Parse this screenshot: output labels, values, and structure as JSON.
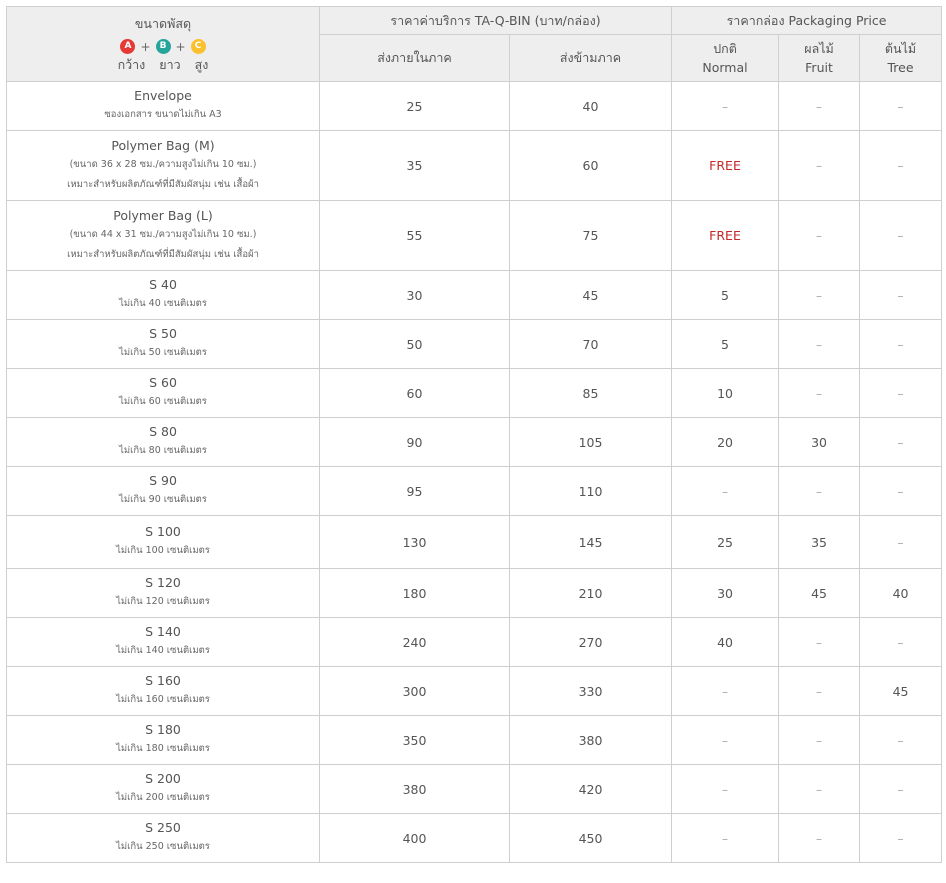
{
  "header": {
    "size_col": "ขนาดพัสดุ",
    "legend": {
      "a": "A",
      "b": "B",
      "c": "C",
      "plus": "+",
      "width": "กว้าง",
      "length": "ยาว",
      "height": "สูง"
    },
    "service_group": "ราคาค่าบริการ TA-Q-BIN (บาท/กล่อง)",
    "packaging_group": "ราคากล่อง Packaging Price",
    "domestic": "ส่งภายในภาค",
    "cross_region": "ส่งข้ามภาค",
    "normal_th": "ปกติ",
    "normal_en": "Normal",
    "fruit_th": "ผลไม้",
    "fruit_en": "Fruit",
    "tree_th": "ต้นไม้",
    "tree_en": "Tree"
  },
  "rows": [
    {
      "name": "Envelope",
      "sub": "ซองเอกสาร ขนาดไม่เกิน A3",
      "domestic": "25",
      "cross": "40",
      "normal": "–",
      "fruit": "–",
      "tree": "–"
    },
    {
      "name": "Polymer Bag (M)",
      "sub": "(ขนาด 36 x 28 ซม./ความสูงไม่เกิน 10 ซม.)",
      "sub2": "เหมาะสำหรับผลิตภัณฑ์ที่มีสัมผัสนุ่ม เช่น เสื้อผ้า",
      "domestic": "35",
      "cross": "60",
      "normal": "FREE",
      "fruit": "–",
      "tree": "–"
    },
    {
      "name": "Polymer Bag (L)",
      "sub": "(ขนาด 44 x 31 ซม./ความสูงไม่เกิน 10 ซม.)",
      "sub2": "เหมาะสำหรับผลิตภัณฑ์ที่มีสัมผัสนุ่ม เช่น เสื้อผ้า",
      "domestic": "55",
      "cross": "75",
      "normal": "FREE",
      "fruit": "–",
      "tree": "–"
    },
    {
      "name": "S 40",
      "sub": "ไม่เกิน 40 เซนติเมตร",
      "domestic": "30",
      "cross": "45",
      "normal": "5",
      "fruit": "–",
      "tree": "–"
    },
    {
      "name": "S 50",
      "sub": "ไม่เกิน 50 เซนติเมตร",
      "domestic": "50",
      "cross": "70",
      "normal": "5",
      "fruit": "–",
      "tree": "–"
    },
    {
      "name": "S 60",
      "sub": "ไม่เกิน 60 เซนติเมตร",
      "domestic": "60",
      "cross": "85",
      "normal": "10",
      "fruit": "–",
      "tree": "–"
    },
    {
      "name": "S 80",
      "sub": "ไม่เกิน 80 เซนติเมตร",
      "domestic": "90",
      "cross": "105",
      "normal": "20",
      "fruit": "30",
      "tree": "–"
    },
    {
      "name": "S 90",
      "sub": "ไม่เกิน 90 เซนติเมตร",
      "domestic": "95",
      "cross": "110",
      "normal": "–",
      "fruit": "–",
      "tree": "–"
    },
    {
      "name": "S 100",
      "sub": "ไม่เกิน 100 เซนติเมตร",
      "domestic": "130",
      "cross": "145",
      "normal": "25",
      "fruit": "35",
      "tree": "–"
    },
    {
      "name": "S 120",
      "sub": "ไม่เกิน 120 เซนติเมตร",
      "domestic": "180",
      "cross": "210",
      "normal": "30",
      "fruit": "45",
      "tree": "40"
    },
    {
      "name": "S 140",
      "sub": "ไม่เกิน 140 เซนติเมตร",
      "domestic": "240",
      "cross": "270",
      "normal": "40",
      "fruit": "–",
      "tree": "–"
    },
    {
      "name": "S 160",
      "sub": "ไม่เกิน 160 เซนติเมตร",
      "domestic": "300",
      "cross": "330",
      "normal": "–",
      "fruit": "–",
      "tree": "45"
    },
    {
      "name": "S 180",
      "sub": "ไม่เกิน 180 เซนติเมตร",
      "domestic": "350",
      "cross": "380",
      "normal": "–",
      "fruit": "–",
      "tree": "–"
    },
    {
      "name": "S 200",
      "sub": "ไม่เกิน 200 เซนติเมตร",
      "domestic": "380",
      "cross": "420",
      "normal": "–",
      "fruit": "–",
      "tree": "–"
    },
    {
      "name": "S 250",
      "sub": "ไม่เกิน 250 เซนติเมตร",
      "domestic": "400",
      "cross": "450",
      "normal": "–",
      "fruit": "–",
      "tree": "–"
    }
  ],
  "colors": {
    "free": "#c62828",
    "dot_a": "#e53935",
    "dot_b": "#26a69a",
    "dot_c": "#fbc02d",
    "header_bg": "#eeeeee"
  }
}
